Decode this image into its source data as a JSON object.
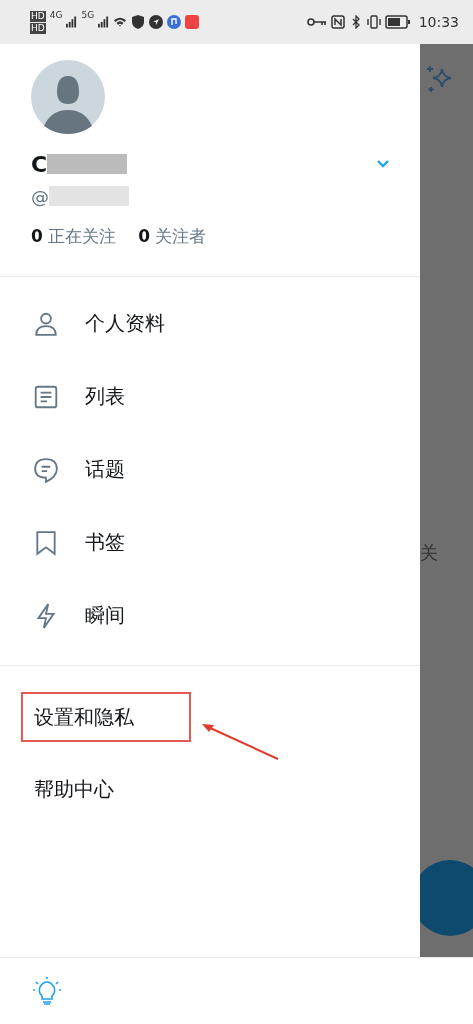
{
  "status_bar": {
    "sim_labels": [
      "HD",
      "HD"
    ],
    "network_labels": [
      "4G",
      "5G"
    ],
    "time": "10:33"
  },
  "drawer": {
    "profile": {
      "name": "C",
      "handle_prefix": "@",
      "stats": [
        {
          "count": "0",
          "label": "正在关注"
        },
        {
          "count": "0",
          "label": "关注者"
        }
      ]
    },
    "menu": [
      {
        "label": "个人资料",
        "kind": "person"
      },
      {
        "label": "列表",
        "kind": "list"
      },
      {
        "label": "话题",
        "kind": "topic"
      },
      {
        "label": "书签",
        "kind": "bookmark"
      },
      {
        "label": "瞬间",
        "kind": "bolt"
      }
    ],
    "secondary_menu": [
      {
        "label": "设置和隐私",
        "highlighted": true
      },
      {
        "label": "帮助中心",
        "highlighted": false
      }
    ]
  },
  "backdrop": {
    "text_fragment": "关"
  }
}
